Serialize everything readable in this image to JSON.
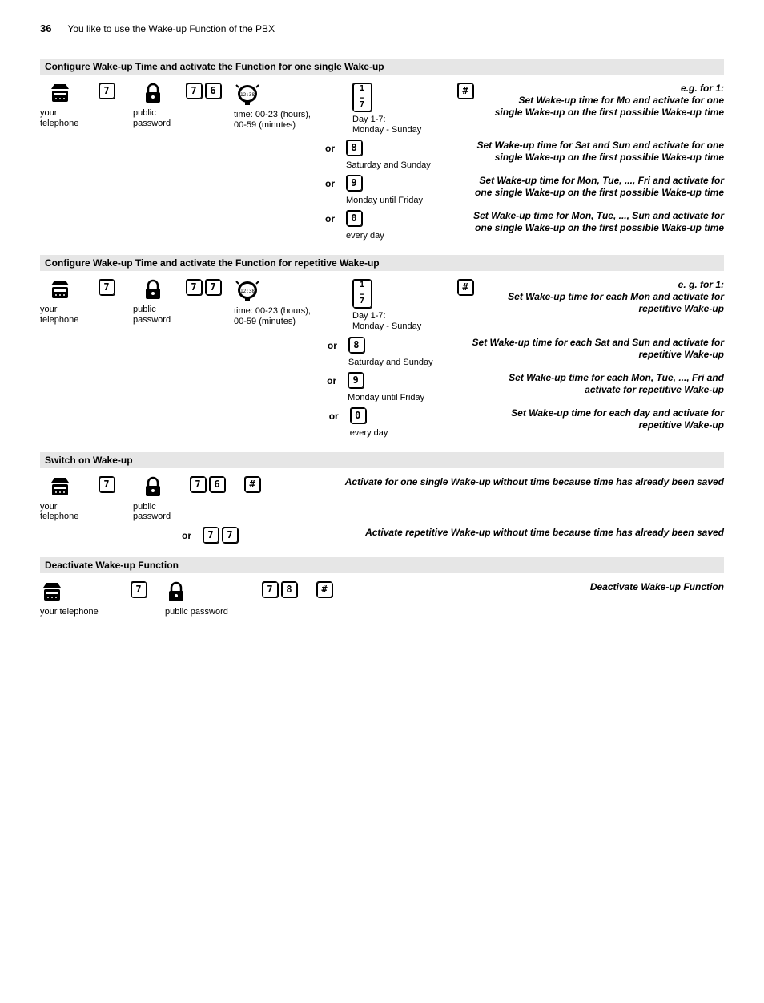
{
  "header": {
    "pageNumber": "36",
    "pageTitle": "You like to use the Wake-up Function of the PBX"
  },
  "labels": {
    "yourTelephone": "your\ntelephone",
    "publicPassword": "public\npassword",
    "publicPasswordOneLine": "public password",
    "yourTelephoneOneLine": "your telephone",
    "time": "time: 00-23 (hours),\n00-59 (minutes)",
    "day17": "Day 1-7:\nMonday - Sunday",
    "satSun": "Saturday and Sunday",
    "monFri": "Monday until Friday",
    "everyDay": "every day",
    "or": "or"
  },
  "sec1": {
    "title": "Configure Wake-up Time and activate the Function for one single Wake-up",
    "keys": {
      "code": [
        "7",
        "6"
      ],
      "hash": "#"
    },
    "stack": [
      "1",
      "…",
      "7"
    ],
    "desc1": "e.g. for 1:\nSet Wake-up time for Mo and activate for one single Wake-up on the first possible Wake-up time",
    "opt8": {
      "key": "8",
      "desc": "Set Wake-up time for Sat and Sun and activate for one single Wake-up on the first possible Wake-up time"
    },
    "opt9": {
      "key": "9",
      "desc": "Set Wake-up time for Mon, Tue, ..., Fri and activate for one single Wake-up on the first possible Wake-up time"
    },
    "opt0": {
      "key": "0",
      "desc": "Set Wake-up time for Mon, Tue, ..., Sun and activate for one single Wake-up on the first possible Wake-up time"
    }
  },
  "sec2": {
    "title": "Configure Wake-up Time and activate the Function for repetitive Wake-up",
    "keys": {
      "code": [
        "7",
        "7"
      ],
      "hash": "#"
    },
    "stack": [
      "1",
      "…",
      "7"
    ],
    "desc1": "e. g. for 1:\nSet Wake-up time for each Mon and activate for repetitive Wake-up",
    "opt8": {
      "key": "8",
      "desc": "Set Wake-up time for each Sat and Sun and activate for repetitive Wake-up"
    },
    "opt9": {
      "key": "9",
      "desc": "Set Wake-up time for each Mon, Tue, ..., Fri and activate for repetitive Wake-up"
    },
    "opt0": {
      "key": "0",
      "desc": "Set Wake-up time for each day and activate for repetitive Wake-up"
    }
  },
  "sec3": {
    "title": "Switch on Wake-up",
    "keys76": [
      "7",
      "6"
    ],
    "keys77": [
      "7",
      "7"
    ],
    "hash": "#",
    "desc76": "Activate for one single Wake-up without time because time has already been saved",
    "desc77": "Activate repetitive Wake-up without time because time has already been saved"
  },
  "sec4": {
    "title": "Deactivate Wake-up Function",
    "keys": [
      "7",
      "8"
    ],
    "hash": "#",
    "desc": "Deactivate Wake-up Function"
  },
  "initKey": "7"
}
